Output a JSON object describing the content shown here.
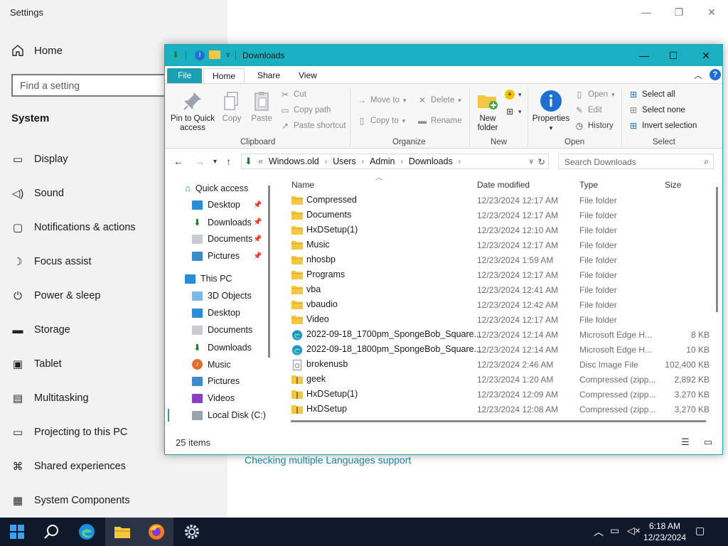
{
  "settings": {
    "title": "Settings",
    "home_label": "Home",
    "search_placeholder": "Find a setting",
    "section": "System",
    "nav": [
      {
        "label": "Display",
        "icon": "display-icon"
      },
      {
        "label": "Sound",
        "icon": "sound-icon"
      },
      {
        "label": "Notifications & actions",
        "icon": "notifications-icon"
      },
      {
        "label": "Focus assist",
        "icon": "focus-assist-icon"
      },
      {
        "label": "Power & sleep",
        "icon": "power-icon"
      },
      {
        "label": "Storage",
        "icon": "storage-icon"
      },
      {
        "label": "Tablet",
        "icon": "tablet-icon"
      },
      {
        "label": "Multitasking",
        "icon": "multitasking-icon"
      },
      {
        "label": "Projecting to this PC",
        "icon": "projecting-icon"
      },
      {
        "label": "Shared experiences",
        "icon": "shared-experiences-icon"
      },
      {
        "label": "System Components",
        "icon": "system-components-icon"
      }
    ],
    "link": "Checking multiple Languages support"
  },
  "explorer": {
    "title": "Downloads",
    "tabs": {
      "file": "File",
      "home": "Home",
      "share": "Share",
      "view": "View"
    },
    "ribbon": {
      "pin_to_quick_access": "Pin to Quick access",
      "copy": "Copy",
      "paste": "Paste",
      "cut": "Cut",
      "copy_path": "Copy path",
      "paste_shortcut": "Paste shortcut",
      "clipboard": "Clipboard",
      "move_to": "Move to",
      "copy_to": "Copy to",
      "delete": "Delete",
      "rename": "Rename",
      "organize": "Organize",
      "new_folder": "New folder",
      "new": "New",
      "properties": "Properties",
      "open": "Open",
      "edit": "Edit",
      "history": "History",
      "open_group": "Open",
      "select_all": "Select all",
      "select_none": "Select none",
      "invert_selection": "Invert selection",
      "select": "Select"
    },
    "address": {
      "crumbs": [
        "Windows.old",
        "Users",
        "Admin",
        "Downloads"
      ],
      "search_placeholder": "Search Downloads"
    },
    "nav_pane": {
      "quick_access": "Quick access",
      "quick_items": [
        "Desktop",
        "Downloads",
        "Documents",
        "Pictures"
      ],
      "this_pc": "This PC",
      "pc_items": [
        "3D Objects",
        "Desktop",
        "Documents",
        "Downloads",
        "Music",
        "Pictures",
        "Videos",
        "Local Disk (C:)"
      ]
    },
    "columns": {
      "name": "Name",
      "date": "Date modified",
      "type": "Type",
      "size": "Size"
    },
    "files": [
      {
        "name": "Compressed",
        "date": "12/23/2024 12:17 AM",
        "type": "File folder",
        "size": "",
        "kind": "folder"
      },
      {
        "name": "Documents",
        "date": "12/23/2024 12:17 AM",
        "type": "File folder",
        "size": "",
        "kind": "folder"
      },
      {
        "name": "HxDSetup(1)",
        "date": "12/23/2024 12:10 AM",
        "type": "File folder",
        "size": "",
        "kind": "folder"
      },
      {
        "name": "Music",
        "date": "12/23/2024 12:17 AM",
        "type": "File folder",
        "size": "",
        "kind": "folder"
      },
      {
        "name": "nhosbp",
        "date": "12/23/2024 1:59 AM",
        "type": "File folder",
        "size": "",
        "kind": "folder"
      },
      {
        "name": "Programs",
        "date": "12/23/2024 12:17 AM",
        "type": "File folder",
        "size": "",
        "kind": "folder"
      },
      {
        "name": "vba",
        "date": "12/23/2024 12:41 AM",
        "type": "File folder",
        "size": "",
        "kind": "folder"
      },
      {
        "name": "vbaudio",
        "date": "12/23/2024 12:42 AM",
        "type": "File folder",
        "size": "",
        "kind": "folder"
      },
      {
        "name": "Video",
        "date": "12/23/2024 12:17 AM",
        "type": "File folder",
        "size": "",
        "kind": "folder"
      },
      {
        "name": "2022-09-18_1700pm_SpongeBob_Square...",
        "date": "12/23/2024 12:14 AM",
        "type": "Microsoft Edge H...",
        "size": "8 KB",
        "kind": "edge"
      },
      {
        "name": "2022-09-18_1800pm_SpongeBob_Square...",
        "date": "12/23/2024 12:14 AM",
        "type": "Microsoft Edge H...",
        "size": "10 KB",
        "kind": "edge"
      },
      {
        "name": "brokenusb",
        "date": "12/23/2024 2:46 AM",
        "type": "Disc Image File",
        "size": "102,400 KB",
        "kind": "disc"
      },
      {
        "name": "geek",
        "date": "12/23/2024 1:20 AM",
        "type": "Compressed (zipp...",
        "size": "2,892 KB",
        "kind": "zip"
      },
      {
        "name": "HxDSetup(1)",
        "date": "12/23/2024 12:09 AM",
        "type": "Compressed (zipp...",
        "size": "3,270 KB",
        "kind": "zip"
      },
      {
        "name": "HxDSetup",
        "date": "12/23/2024 12:08 AM",
        "type": "Compressed (zipp...",
        "size": "3,270 KB",
        "kind": "zip"
      }
    ],
    "status": {
      "item_count": "25 items"
    }
  },
  "taskbar": {
    "time": "6:18 AM",
    "date": "12/23/2024"
  },
  "colors": {
    "accent": "#1ab0c1",
    "folder": "#f3c743",
    "taskbar": "#10192a"
  }
}
